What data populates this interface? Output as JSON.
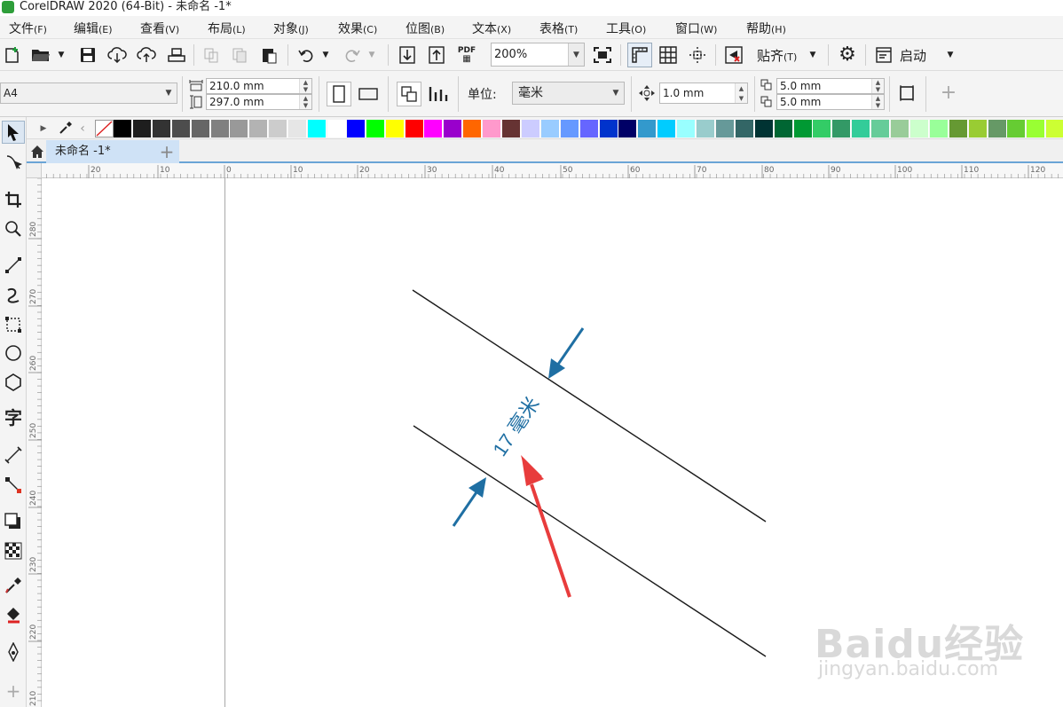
{
  "title": {
    "text": "CorelDRAW 2020 (64-Bit) - 未命名 -1*"
  },
  "menu": [
    {
      "label": "文件",
      "key": "(F)"
    },
    {
      "label": "编辑",
      "key": "(E)"
    },
    {
      "label": "查看",
      "key": "(V)"
    },
    {
      "label": "布局",
      "key": "(L)"
    },
    {
      "label": "对象",
      "key": "(J)"
    },
    {
      "label": "效果",
      "key": "(C)"
    },
    {
      "label": "位图",
      "key": "(B)"
    },
    {
      "label": "文本",
      "key": "(X)"
    },
    {
      "label": "表格",
      "key": "(T)"
    },
    {
      "label": "工具",
      "key": "(O)"
    },
    {
      "label": "窗口",
      "key": "(W)"
    },
    {
      "label": "帮助",
      "key": "(H)"
    }
  ],
  "toolbar": {
    "pdf_label": "PDF",
    "zoom": "200%",
    "snap_label": "贴齐",
    "snap_key": "(T)",
    "launch_label": "启动"
  },
  "props": {
    "page_size": "A4",
    "width": "210.0 mm",
    "height": "297.0 mm",
    "unit_label": "单位:",
    "unit": "毫米",
    "nudge": "1.0 mm",
    "dup_x": "5.0 mm",
    "dup_y": "5.0 mm"
  },
  "document": {
    "tab": "未命名 -1*"
  },
  "palette_colors": [
    "#000000",
    "#1e1e1e",
    "#333333",
    "#4d4d4d",
    "#666666",
    "#808080",
    "#999999",
    "#b3b3b3",
    "#cccccc",
    "#e6e6e6",
    "#00ffff",
    "#ffffff",
    "#0000ff",
    "#00ff00",
    "#ffff00",
    "#ff0000",
    "#ff00ff",
    "#9900cc",
    "#ff6600",
    "#ff99cc",
    "#663333",
    "#ccccff",
    "#99ccff",
    "#6699ff",
    "#6666ff",
    "#0033cc",
    "#000066",
    "#3399cc",
    "#00ccff",
    "#99ffff",
    "#99cccc",
    "#669999",
    "#336666",
    "#003333",
    "#006633",
    "#009933",
    "#33cc66",
    "#339966",
    "#33cc99",
    "#66cc99",
    "#99cc99",
    "#ccffcc",
    "#99ff99",
    "#669933",
    "#99cc33",
    "#669966",
    "#66cc33",
    "#99ff33",
    "#ccff33"
  ],
  "ruler_h": [
    "20",
    "10",
    "0",
    "10",
    "20",
    "30",
    "40",
    "50",
    "60",
    "70",
    "80",
    "90",
    "100",
    "110",
    "120"
  ],
  "ruler_v": [
    "280",
    "270",
    "260",
    "250",
    "240",
    "230",
    "220",
    "210"
  ],
  "drawing": {
    "dimension_text": "17 毫米",
    "line_color": "#1b1b1b",
    "dimension_color": "#1f6fa3",
    "arrow_color": "#e83c3c"
  },
  "watermark": {
    "brand": "Baidu经验",
    "url": "jingyan.baidu.com"
  }
}
